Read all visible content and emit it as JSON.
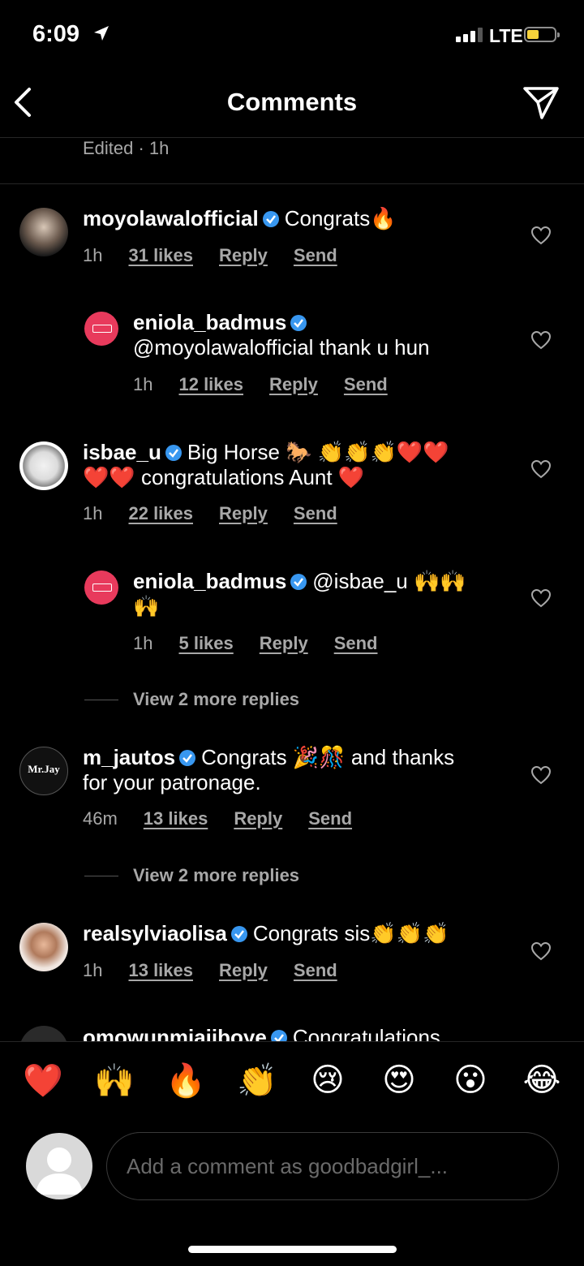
{
  "status_bar": {
    "time": "6:09",
    "network": "LTE",
    "battery_color": "#f7d33b"
  },
  "header": {
    "title": "Comments"
  },
  "edited_label": "Edited · 1h",
  "comments": [
    {
      "username": "moyolawalofficial",
      "text": "Congrats",
      "emoji": "🔥",
      "time": "1h",
      "likes": "31 likes",
      "reply": "Reply",
      "send": "Send"
    },
    {
      "username": "eniola_badmus",
      "text": "@moyolawalofficial thank u hun",
      "time": "1h",
      "likes": "12 likes",
      "reply": "Reply",
      "send": "Send"
    },
    {
      "username": "isbae_u",
      "text_a": "Big Horse",
      "emoji_a": "🐎 👏👏👏❤️❤️",
      "emoji_b": "❤️❤️",
      "text_b": "congratulations Aunt",
      "emoji_c": "❤️",
      "time": "1h",
      "likes": "22 likes",
      "reply": "Reply",
      "send": "Send"
    },
    {
      "username": "eniola_badmus",
      "text": "@isbae_u",
      "emoji_a": "🙌🙌",
      "emoji_b": "🙌",
      "time": "1h",
      "likes": "5 likes",
      "reply": "Reply",
      "send": "Send"
    },
    {
      "username": "m_jautos",
      "text_a": "Congrats",
      "emoji": "🎉🎊",
      "text_b": "and thanks",
      "text_c": "for your patronage.",
      "time": "46m",
      "likes": "13 likes",
      "reply": "Reply",
      "send": "Send",
      "avatar_text": "Mr.Jay"
    },
    {
      "username": "realsylviaolisa",
      "text": "Congrats sis",
      "emoji": "👏👏👏",
      "time": "1h",
      "likes": "13 likes",
      "reply": "Reply",
      "send": "Send"
    },
    {
      "username": "omowunmiajiboye",
      "text": "Congratulations"
    }
  ],
  "view_more": [
    "View 2 more replies",
    "View 2 more replies"
  ],
  "reactions": [
    "❤️",
    "🙌",
    "🔥",
    "👏",
    "😢",
    "😍",
    "😮",
    "😂"
  ],
  "composer": {
    "placeholder": "Add a comment as goodbadgirl_..."
  },
  "colors": {
    "background": "#000000",
    "secondary_text": "#a8a8a8",
    "verified": "#3897f0"
  }
}
